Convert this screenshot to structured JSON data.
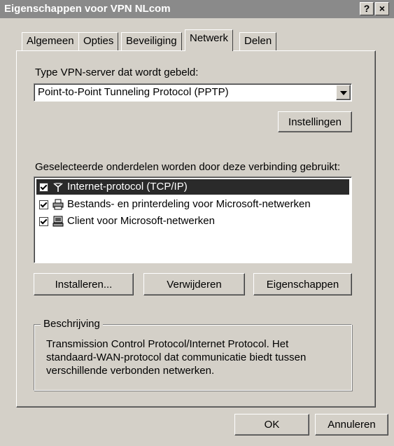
{
  "window": {
    "title": "Eigenschappen voor VPN NLcom",
    "help_button": "?",
    "close_button": "×"
  },
  "tabs": [
    {
      "label": "Algemeen"
    },
    {
      "label": "Opties"
    },
    {
      "label": "Beveiliging"
    },
    {
      "label": "Netwerk"
    },
    {
      "label": "Delen"
    }
  ],
  "vpn_type": {
    "label": "Type VPN-server dat wordt gebeld:",
    "selected": "Point-to-Point Tunneling Protocol (PPTP)",
    "settings_button": "Instellingen"
  },
  "components": {
    "label": "Geselecteerde onderdelen worden door deze verbinding gebruikt:",
    "items": [
      {
        "label": "Internet-protocol (TCP/IP)",
        "icon": "network-protocol-icon"
      },
      {
        "label": "Bestands- en printerdeling voor Microsoft-netwerken",
        "icon": "file-printer-sharing-icon"
      },
      {
        "label": "Client voor Microsoft-netwerken",
        "icon": "network-client-icon"
      }
    ],
    "install_button": "Installeren...",
    "remove_button": "Verwijderen",
    "properties_button": "Eigenschappen"
  },
  "description": {
    "legend": "Beschrijving",
    "text": "Transmission Control Protocol/Internet Protocol. Het standaard-WAN-protocol dat communicatie biedt tussen verschillende verbonden netwerken."
  },
  "footer": {
    "ok_button": "OK",
    "cancel_button": "Annuleren"
  }
}
